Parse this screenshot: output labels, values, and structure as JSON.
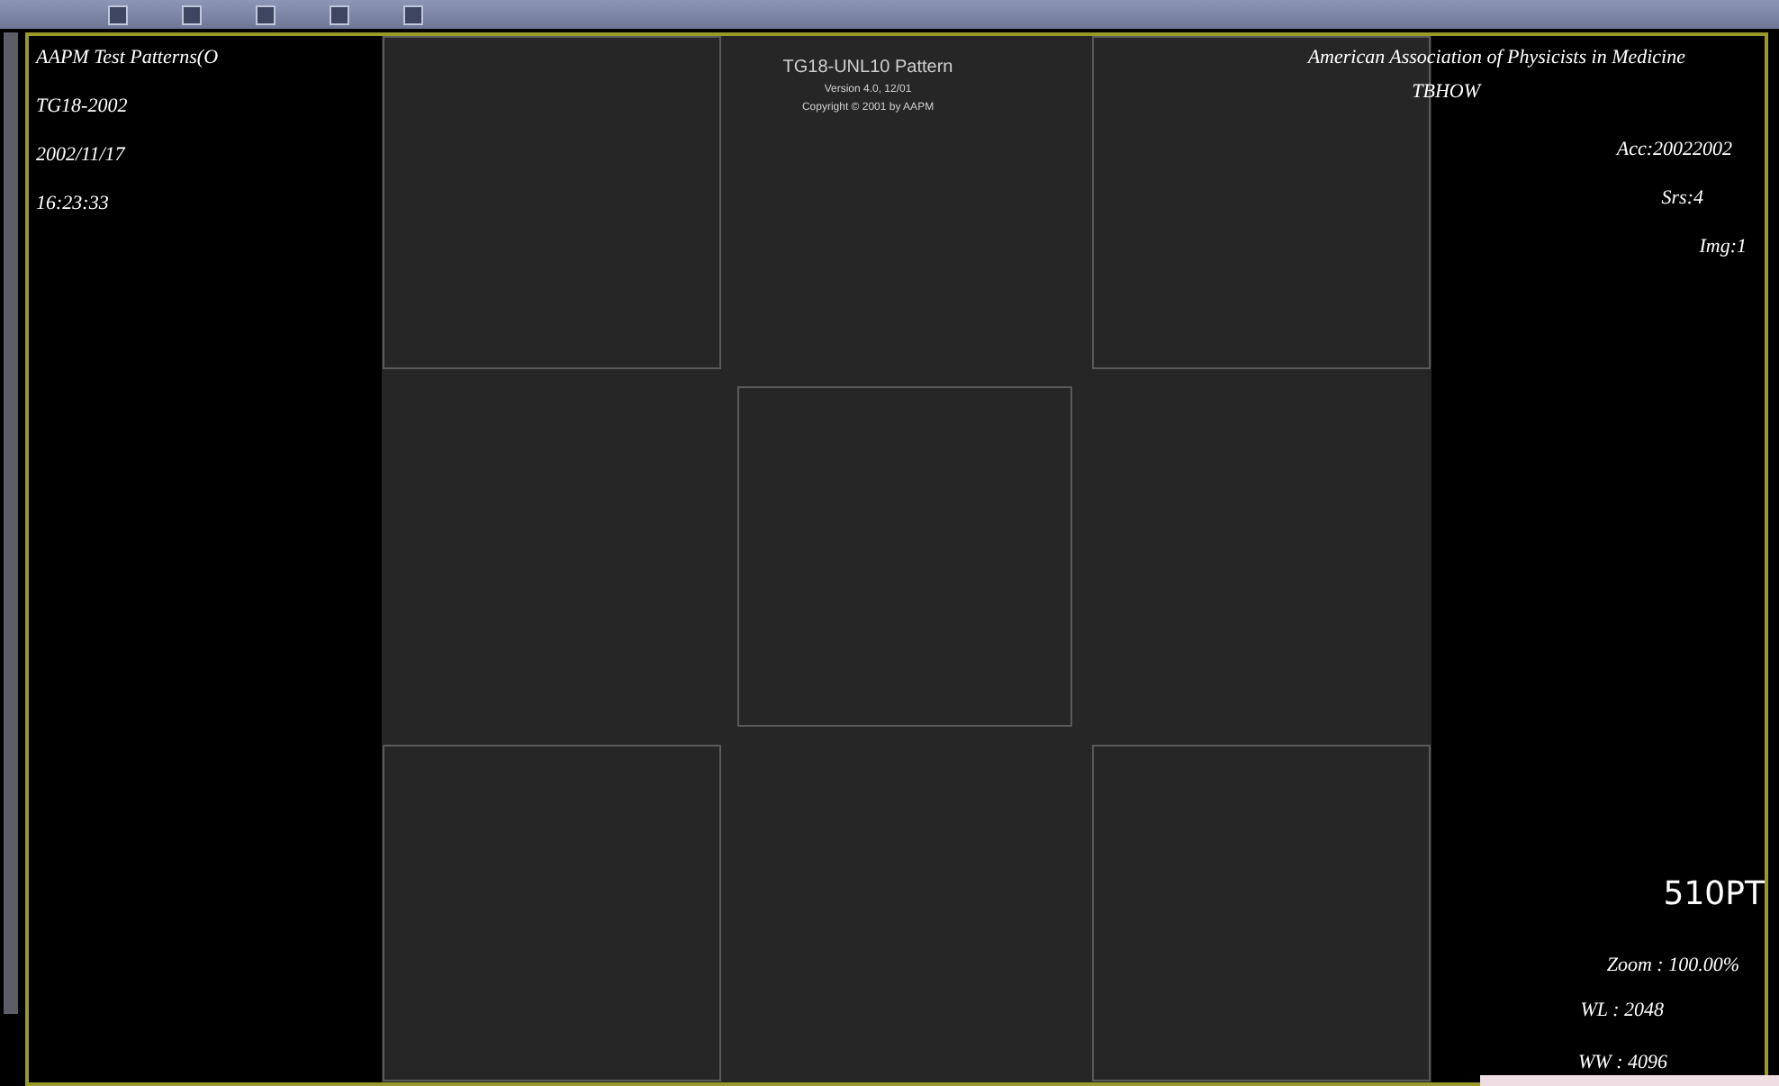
{
  "viewer": {
    "pattern_text": [
      "TG18-UNL10 Pattern",
      "Version 4.0, 12/01",
      "Copyright © 2001 by AAPM"
    ],
    "top_left": [
      "AAPM Test Patterns(O",
      "TG18-2002",
      "2002/11/17",
      "16:23:33"
    ],
    "top_right": [
      "American Association of Physicists in Medicine",
      "TBHOW",
      "Acc:20022002",
      "Srs:4",
      "Img:1"
    ],
    "orientation_marker": "510PT",
    "bottom_right": [
      "Zoom : 100.00%",
      "WL : 2048",
      "WW : 4096"
    ]
  }
}
